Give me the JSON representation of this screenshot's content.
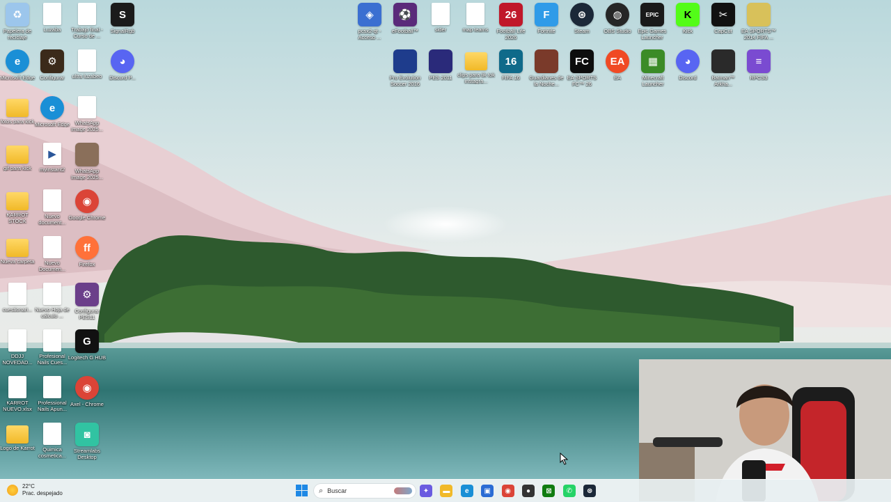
{
  "desktop": {
    "left_icons": [
      {
        "label": "Papelera de reciclaje",
        "icon": "recycle-bin-icon",
        "color": "#9cc6ec",
        "glyph": "♻",
        "kind": "app"
      },
      {
        "label": "Luzaba",
        "icon": "file-icon",
        "color": "#ffffff",
        "glyph": "",
        "kind": "doc"
      },
      {
        "label": "Trabajo final - Curso de ...",
        "icon": "document-icon",
        "color": "#ffffff",
        "glyph": "",
        "kind": "doc"
      },
      {
        "label": "SignalRgb",
        "icon": "signalrgb-icon",
        "color": "#1b1b1b",
        "glyph": "S",
        "kind": "app"
      },
      {
        "label": "Microsoft Edge",
        "icon": "edge-icon",
        "color": "#1a8fd6",
        "glyph": "e",
        "kind": "round"
      },
      {
        "label": "Configurar",
        "icon": "pes-config-icon",
        "color": "#3b2a1a",
        "glyph": "⚙",
        "kind": "app"
      },
      {
        "label": "ultra luzabeo",
        "icon": "file-icon",
        "color": "#ffffff",
        "glyph": "",
        "kind": "doc"
      },
      {
        "label": "Discord P...",
        "icon": "discord-icon",
        "color": "#5865f2",
        "glyph": "◕",
        "kind": "round"
      },
      {
        "label": "fotos para kick",
        "icon": "folder-icon",
        "color": "#f1b928",
        "glyph": "",
        "kind": "folder"
      },
      {
        "label": "Microsoft Edge",
        "icon": "edge-icon",
        "color": "#1a8fd6",
        "glyph": "e",
        "kind": "round"
      },
      {
        "label": "WhatsApp Image 2025...",
        "icon": "image-icon",
        "color": "#efe7d6",
        "glyph": "",
        "kind": "doc"
      },
      {
        "label": "gif para kick",
        "icon": "folder-icon",
        "color": "#f1b928",
        "glyph": "",
        "kind": "folder"
      },
      {
        "label": "myinstant2",
        "icon": "media-file-icon",
        "color": "#ffffff",
        "glyph": "▶",
        "kind": "doc"
      },
      {
        "label": "WhatsApp Image 2025...",
        "icon": "image-icon",
        "color": "#8a6f5a",
        "glyph": "",
        "kind": "app"
      },
      {
        "label": "KARROT STOCK",
        "icon": "folder-icon",
        "color": "#f1b928",
        "glyph": "",
        "kind": "folder"
      },
      {
        "label": "Nuevo document...",
        "icon": "document-icon",
        "color": "#ffffff",
        "glyph": "",
        "kind": "doc"
      },
      {
        "label": "Google Chrome",
        "icon": "chrome-icon",
        "color": "#db4437",
        "glyph": "◉",
        "kind": "round"
      },
      {
        "label": "Nueva carpeta",
        "icon": "folder-icon",
        "color": "#f1b928",
        "glyph": "",
        "kind": "folder"
      },
      {
        "label": "Nuevo Documen...",
        "icon": "document-icon",
        "color": "#ffffff",
        "glyph": "",
        "kind": "doc"
      },
      {
        "label": "Firefox",
        "icon": "firefox-icon",
        "color": "#ff7139",
        "glyph": "ff",
        "kind": "round"
      },
      {
        "label": "cuestionari...",
        "icon": "document-icon",
        "color": "#ffffff",
        "glyph": "",
        "kind": "doc"
      },
      {
        "label": "Nuevo Hoja de cálculo ...",
        "icon": "spreadsheet-icon",
        "color": "#ffffff",
        "glyph": "",
        "kind": "doc"
      },
      {
        "label": "Configurar PES11",
        "icon": "pes11-config-icon",
        "color": "#6b3f8a",
        "glyph": "⚙",
        "kind": "app"
      },
      {
        "label": "DDJJ NOVEDAD...",
        "icon": "document-icon",
        "color": "#ffffff",
        "glyph": "",
        "kind": "doc"
      },
      {
        "label": "Profesional Nails Cues...",
        "icon": "document-icon",
        "color": "#ffffff",
        "glyph": "",
        "kind": "doc"
      },
      {
        "label": "Logitech G HUB",
        "icon": "logitech-g-icon",
        "color": "#111111",
        "glyph": "G",
        "kind": "app"
      },
      {
        "label": "KARROT NUEVO.xlsx",
        "icon": "spreadsheet-icon",
        "color": "#ffffff",
        "glyph": "",
        "kind": "doc"
      },
      {
        "label": "Professional Nails Apun...",
        "icon": "document-icon",
        "color": "#ffffff",
        "glyph": "",
        "kind": "doc"
      },
      {
        "label": "Axel - Chrome",
        "icon": "chrome-icon",
        "color": "#db4437",
        "glyph": "◉",
        "kind": "round"
      },
      {
        "label": "Logo de Karrot",
        "icon": "image-icon",
        "color": "#f1b928",
        "glyph": "",
        "kind": "folder"
      },
      {
        "label": "Quimica cosmetica...",
        "icon": "document-icon",
        "color": "#ffffff",
        "glyph": "",
        "kind": "doc"
      },
      {
        "label": "Streamlabs Desktop",
        "icon": "streamlabs-icon",
        "color": "#31c3a2",
        "glyph": "◙",
        "kind": "app"
      }
    ],
    "right_icons": [
      {
        "label": "pcsx2-qt - Acceso ...",
        "icon": "pcsx2-icon",
        "color": "#3b6fd1",
        "glyph": "◈",
        "kind": "app"
      },
      {
        "label": "eFootball™",
        "icon": "efootball-icon",
        "color": "#5a2a7a",
        "glyph": "⚽",
        "kind": "app"
      },
      {
        "label": "sider",
        "icon": "file-icon",
        "color": "#ffffff",
        "glyph": "",
        "kind": "doc"
      },
      {
        "label": "map teams",
        "icon": "document-icon",
        "color": "#ffffff",
        "glyph": "",
        "kind": "doc"
      },
      {
        "label": "Football Life 2026",
        "icon": "football-life-icon",
        "color": "#c0182a",
        "glyph": "26",
        "kind": "app"
      },
      {
        "label": "Fortnite",
        "icon": "fortnite-icon",
        "color": "#2f9be8",
        "glyph": "F",
        "kind": "app"
      },
      {
        "label": "Steam",
        "icon": "steam-icon",
        "color": "#1b2838",
        "glyph": "⊛",
        "kind": "round"
      },
      {
        "label": "OBS Studio",
        "icon": "obs-icon",
        "color": "#262626",
        "glyph": "◍",
        "kind": "round"
      },
      {
        "label": "Epic Games Launcher",
        "icon": "epic-games-icon",
        "color": "#1a1a1a",
        "glyph": "EPIC",
        "kind": "app"
      },
      {
        "label": "Kick",
        "icon": "kick-icon",
        "color": "#53fc18",
        "glyph": "K",
        "kind": "app"
      },
      {
        "label": "CapCut",
        "icon": "capcut-icon",
        "color": "#111111",
        "glyph": "✂",
        "kind": "app"
      },
      {
        "label": "EA SPORTS™ 2014 FIFA ...",
        "icon": "fifa-world-cup-icon",
        "color": "#d8c15a",
        "glyph": "",
        "kind": "app"
      },
      {
        "label": "Pro Evolution Soccer 2016",
        "icon": "pes2016-icon",
        "color": "#1e3c8c",
        "glyph": "",
        "kind": "app"
      },
      {
        "label": "PES 2011",
        "icon": "pes2011-icon",
        "color": "#2a2a7a",
        "glyph": "",
        "kind": "app"
      },
      {
        "label": "clips para tik tok instagra...",
        "icon": "folder-icon",
        "color": "#f1b928",
        "glyph": "",
        "kind": "folder"
      },
      {
        "label": "FIFA 16",
        "icon": "fifa16-icon",
        "color": "#0f6a8a",
        "glyph": "16",
        "kind": "app"
      },
      {
        "label": "Guardianes de la Noche...",
        "icon": "guardianes-icon",
        "color": "#7a3a2a",
        "glyph": "",
        "kind": "app"
      },
      {
        "label": "EA SPORTS FC™ 26",
        "icon": "ea-fc26-icon",
        "color": "#0d0d0d",
        "glyph": "FC",
        "kind": "app"
      },
      {
        "label": "EA",
        "icon": "ea-icon",
        "color": "#f04a24",
        "glyph": "EA",
        "kind": "round"
      },
      {
        "label": "Minecraft Launcher",
        "icon": "minecraft-icon",
        "color": "#3b8b27",
        "glyph": "▦",
        "kind": "app"
      },
      {
        "label": "Discord",
        "icon": "discord-icon",
        "color": "#5865f2",
        "glyph": "◕",
        "kind": "round"
      },
      {
        "label": "Batman™ Arkha...",
        "icon": "batman-icon",
        "color": "#2a2a2a",
        "glyph": "",
        "kind": "app"
      },
      {
        "label": "RPCS3",
        "icon": "rpcs3-icon",
        "color": "#7a4bd1",
        "glyph": "≡",
        "kind": "app"
      }
    ]
  },
  "taskbar": {
    "weather": {
      "temp": "22°C",
      "condition": "Prac. despejado"
    },
    "search_placeholder": "Buscar",
    "pinned": [
      {
        "name": "copilot-taskbar-icon",
        "color": "#6a5be0",
        "glyph": "✦"
      },
      {
        "name": "file-explorer-taskbar-icon",
        "color": "#f1b928",
        "glyph": "▬"
      },
      {
        "name": "edge-taskbar-icon",
        "color": "#1a8fd6",
        "glyph": "e"
      },
      {
        "name": "store-taskbar-icon",
        "color": "#2b6cd4",
        "glyph": "▣"
      },
      {
        "name": "chrome-taskbar-icon",
        "color": "#db4437",
        "glyph": "◉"
      },
      {
        "name": "game-taskbar-icon",
        "color": "#333333",
        "glyph": "●"
      },
      {
        "name": "xbox-taskbar-icon",
        "color": "#107c10",
        "glyph": "⊠"
      },
      {
        "name": "whatsapp-taskbar-icon",
        "color": "#25d366",
        "glyph": "✆"
      },
      {
        "name": "steam-taskbar-icon",
        "color": "#1b2838",
        "glyph": "⊛"
      }
    ]
  }
}
